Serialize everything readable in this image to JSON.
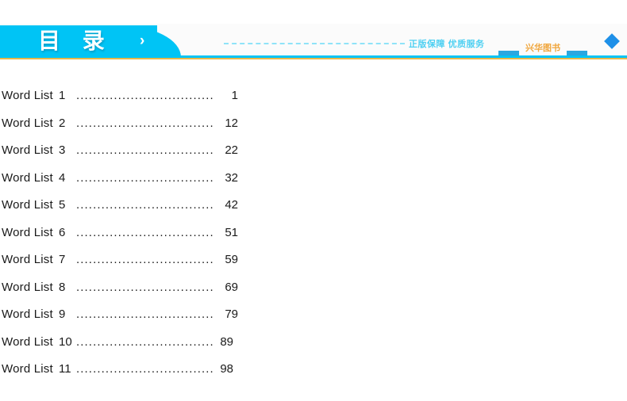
{
  "header": {
    "tab_title": "目 录",
    "chevron": "›",
    "slogan": "正版保障 优质服务",
    "shop_name": "兴华图书",
    "colors": {
      "cyan": "#00c4f5",
      "orange_rule": "#e8b84b",
      "shop_name": "#f0a63c",
      "shop_bar": "#2aa7e0",
      "diamond": "#1e90e8",
      "slogan": "#4fd0f2",
      "dashes": "#8fe3f8"
    }
  },
  "toc": {
    "dots": "..............................................",
    "dots_long": "................................................",
    "entries": [
      {
        "label": "Word List",
        "number": "1",
        "page": "1"
      },
      {
        "label": "Word List",
        "number": "2",
        "page": "12"
      },
      {
        "label": "Word List",
        "number": "3",
        "page": "22"
      },
      {
        "label": "Word List",
        "number": "4",
        "page": "32"
      },
      {
        "label": "Word List",
        "number": "5",
        "page": "42"
      },
      {
        "label": "Word List",
        "number": "6",
        "page": "51"
      },
      {
        "label": "Word List",
        "number": "7",
        "page": "59"
      },
      {
        "label": "Word List",
        "number": "8",
        "page": "69"
      },
      {
        "label": "Word List",
        "number": "9",
        "page": "79"
      },
      {
        "label": "Word List",
        "number": "10",
        "page": "89"
      },
      {
        "label": "Word List",
        "number": "11",
        "page": "98"
      }
    ]
  }
}
